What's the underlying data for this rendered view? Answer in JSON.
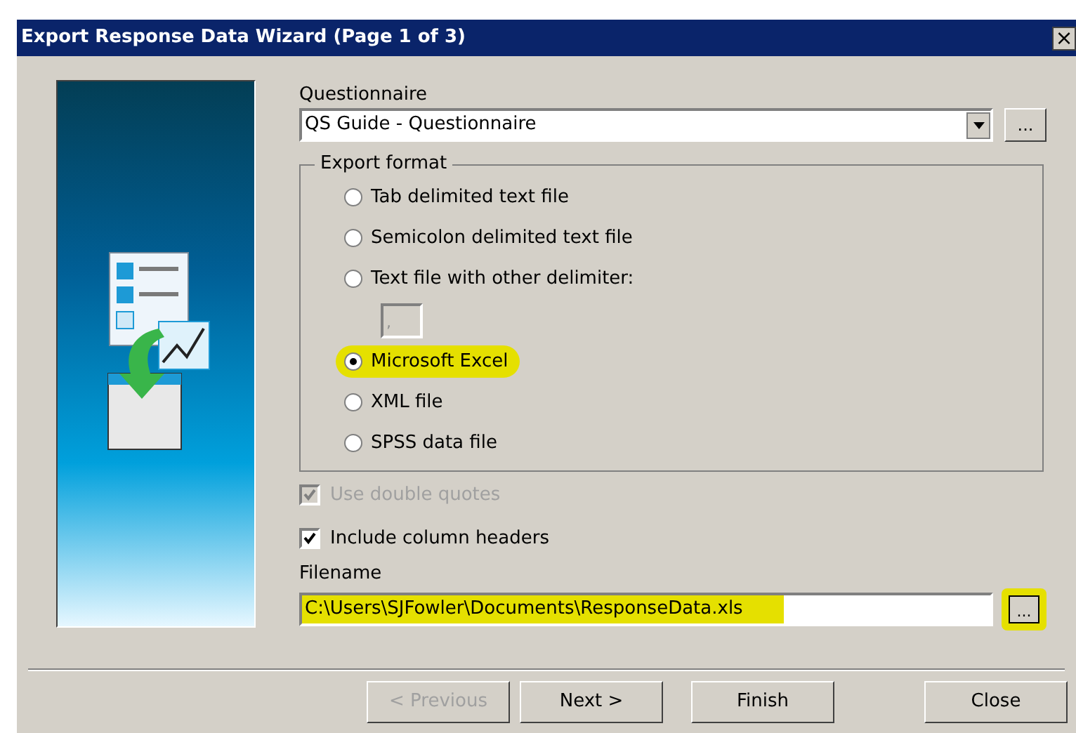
{
  "window": {
    "title": "Export Response Data Wizard (Page 1 of 3)",
    "close": "×"
  },
  "questionnaire": {
    "label": "Questionnaire",
    "value": "QS Guide - Questionnaire",
    "browse": "..."
  },
  "export_format": {
    "label": "Export format",
    "delimiter": {
      "value": ",",
      "disabled": true
    },
    "options": [
      {
        "label": "Tab delimited text file",
        "selected": false,
        "highlighted": false
      },
      {
        "label": "Semicolon delimited text file",
        "selected": false,
        "highlighted": false
      },
      {
        "label": "Text file with other delimiter:",
        "selected": false,
        "highlighted": false
      },
      {
        "label": "Microsoft Excel",
        "selected": true,
        "highlighted": true
      },
      {
        "label": "XML file",
        "selected": false,
        "highlighted": false
      },
      {
        "label": "SPSS data file",
        "selected": false,
        "highlighted": false
      }
    ]
  },
  "checkboxes": [
    {
      "label": "Use double quotes",
      "checked": true,
      "disabled": true
    },
    {
      "label": "Include column headers",
      "checked": true,
      "disabled": false
    }
  ],
  "filename": {
    "label": "Filename",
    "value": "C:\\Users\\SJFowler\\Documents\\ResponseData.xls",
    "highlighted": true,
    "browse": "...",
    "browse_highlighted": true
  },
  "buttons": [
    {
      "label": "< Previous",
      "disabled": true
    },
    {
      "label": "Next >",
      "disabled": false
    },
    {
      "label": "Finish",
      "disabled": false
    },
    {
      "label": "Close",
      "disabled": false
    }
  ]
}
